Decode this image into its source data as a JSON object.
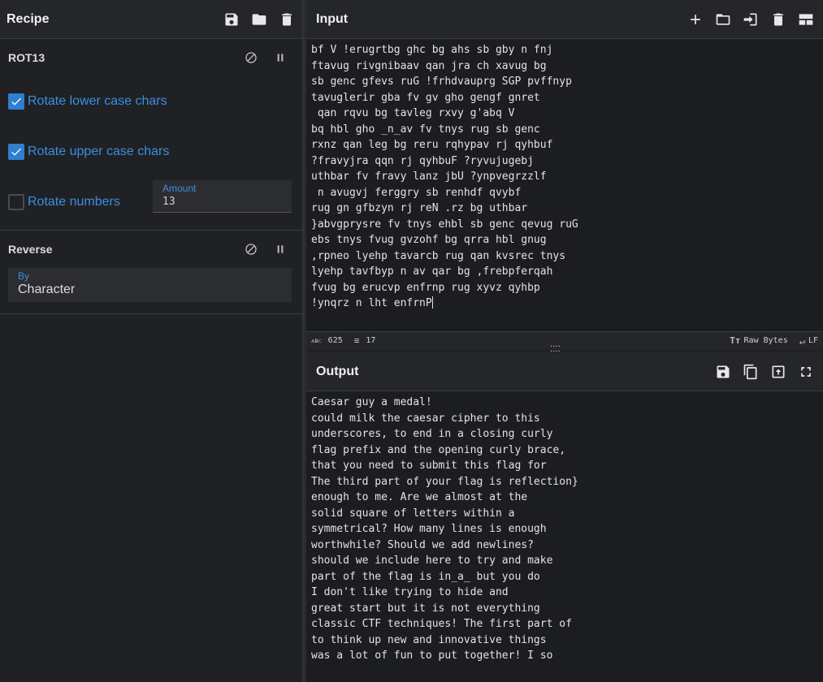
{
  "recipe": {
    "title": "Recipe",
    "icons": [
      "save-icon",
      "folder-icon",
      "trash-icon"
    ]
  },
  "operations": {
    "rot13": {
      "title": "ROT13",
      "options": [
        {
          "label": "Rotate lower case chars",
          "checked": true
        },
        {
          "label": "Rotate upper case chars",
          "checked": true
        },
        {
          "label": "Rotate numbers",
          "checked": false
        }
      ],
      "amount_label": "Amount",
      "amount_value": "13"
    },
    "reverse": {
      "title": "Reverse",
      "by_label": "By",
      "by_value": "Character"
    }
  },
  "input": {
    "title": "Input",
    "text": "bf V !erugrtbg ghc bg ahs sb gby n fnj\nftavug rivgnibaav qan jra ch xavug bg\nsb genc gfevs ruG !frhdvauprg SGP pvffnyp\ntavuglerir gba fv gv gho gengf gnret\n qan rqvu bg tavleg rxvy g'abq V\nbq hbl gho _n_av fv tnys rug sb genc\nrxnz qan leg bg reru rqhypav rj qyhbuf\n?fravyjra qqn rj qyhbuF ?ryvujugebj\nuthbar fv fravy lanz jbU ?ynpvegrzzlf\n n avugvj ferggry sb renhdf qvybf\nrug gn gfbzyn rj reN .rz bg uthbar\n}abvgprysre fv tnys ehbl sb genc qevug ruG\nebs tnys fvug gvzohf bg qrra hbl gnug\n,rpneo lyehp tavarcb rug qan kvsrec tnys\nlyehp tavfbyp n av qar bg ,frebpferqah\nfvug bg erucvp enfrnp rug xyvz qyhbp\n!ynqrz n lht enfrnP",
    "length": "625",
    "lines": "17",
    "raw_bytes": "Raw Bytes",
    "eol": "LF"
  },
  "output": {
    "title": "Output",
    "text": "Caesar guy a medal!\ncould milk the caesar cipher to this\nunderscores, to end in a closing curly\nflag prefix and the opening curly brace,\nthat you need to submit this flag for\nThe third part of your flag is reflection}\nenough to me. Are we almost at the\nsolid square of letters within a\nsymmetrical? How many lines is enough\nworthwhile? Should we add newlines?\nshould we include here to try and make\npart of the flag is in_a_ but you do\nI don't like trying to hide and\ngreat start but it is not everything\nclassic CTF techniques! The first part of\nto think up new and innovative things\nwas a lot of fun to put together! I so"
  }
}
